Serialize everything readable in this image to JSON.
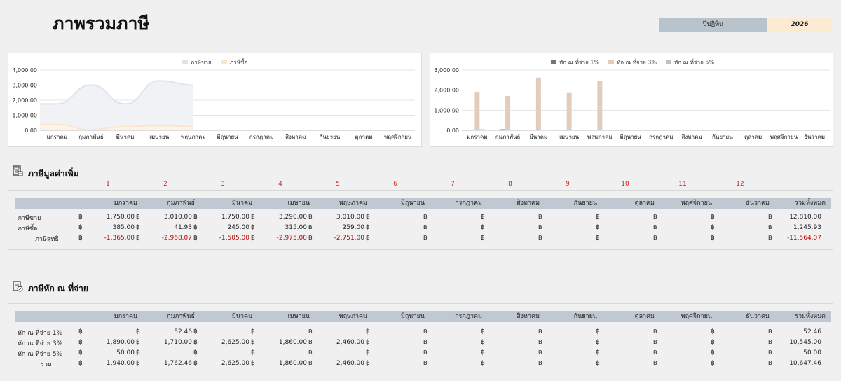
{
  "page": {
    "title": "ภาพรวมภาษี",
    "fiscal_year_label": "ปีปฏิทิน",
    "fiscal_year_value": "2026"
  },
  "months": [
    "มกราคม",
    "กุมภาพันธ์",
    "มีนาคม",
    "เมษายน",
    "พฤษภาคม",
    "มิถุนายน",
    "กรกฎาคม",
    "สิงหาคม",
    "กันยายน",
    "ตุลาคม",
    "พฤศจิกายน",
    "ธันวาคม"
  ],
  "total_label": "รวมทั้งหมด",
  "currency": "฿",
  "chart_data": [
    {
      "type": "area",
      "legend": [
        "ภาษีขาย",
        "ภาษีซื้อ"
      ],
      "legend_position": "top",
      "categories": [
        "มกราคม",
        "กุมภาพันธ์",
        "มีนาคม",
        "เมษายน",
        "พฤษภาคม",
        "มิถุนายน",
        "กรกฎาคม",
        "สิงหาคม",
        "กันยายน",
        "ตุลาคม",
        "พฤศจิกายน"
      ],
      "series": [
        {
          "name": "ภาษีขาย",
          "values": [
            1750,
            3010,
            1750,
            3290,
            3010
          ],
          "color": "#dfe3ec"
        },
        {
          "name": "ภาษีซื้อ",
          "values": [
            385,
            41.93,
            245,
            315,
            259
          ],
          "color": "#fbe6cd"
        }
      ],
      "yticks": [
        "0.00",
        "1,000.00",
        "2,000.00",
        "3,000.00",
        "4,000.00"
      ],
      "ylim": [
        0,
        4000
      ],
      "grid": true
    },
    {
      "type": "bar",
      "legend": [
        "หัก ณ ที่จ่าย 1%",
        "หัก ณ ที่จ่าย 3%",
        "หัก ณ ที่จ่าย 5%"
      ],
      "legend_position": "top",
      "categories": [
        "มกราคม",
        "กุมภาพันธ์",
        "มีนาคม",
        "เมษายน",
        "พฤษภาคม",
        "มิถุนายน",
        "กรกฎาคม",
        "สิงหาคม",
        "กันยายน",
        "ตุลาคม",
        "พฤศจิกายน",
        "ธันวาคม"
      ],
      "series": [
        {
          "name": "หัก ณ ที่จ่าย 1%",
          "values": [
            0,
            52.46,
            0,
            0,
            0,
            0,
            0,
            0,
            0,
            0,
            0,
            0
          ],
          "color": "#7a7470"
        },
        {
          "name": "หัก ณ ที่จ่าย 3%",
          "values": [
            1890,
            1710,
            2625,
            1860,
            2460,
            0,
            0,
            0,
            0,
            0,
            0,
            0
          ],
          "color": "#e2cdbd"
        },
        {
          "name": "หัก ณ ที่จ่าย 5%",
          "values": [
            50,
            0,
            0,
            0,
            0,
            0,
            0,
            0,
            0,
            0,
            0,
            0
          ],
          "color": "#b9c3cc"
        }
      ],
      "yticks": [
        "0.00",
        "1,000.00",
        "2,000.00",
        "3,000.00"
      ],
      "ylim": [
        0,
        3000
      ],
      "grid": true
    }
  ],
  "vat": {
    "title": "ภาษีมูลค่าเพิ่ม",
    "month_numbers": [
      "1",
      "2",
      "3",
      "4",
      "5",
      "6",
      "7",
      "8",
      "9",
      "10",
      "11",
      "12"
    ],
    "rows": [
      {
        "label": "ภาษีขาย",
        "values": [
          "1,750.00",
          "3,010.00",
          "1,750.00",
          "3,290.00",
          "3,010.00",
          "",
          "",
          "",
          "",
          "",
          "",
          ""
        ],
        "total": "12,810.00",
        "negative": false
      },
      {
        "label": "ภาษีซื้อ",
        "values": [
          "385.00",
          "41.93",
          "245.00",
          "315.00",
          "259.00",
          "",
          "",
          "",
          "",
          "",
          "",
          ""
        ],
        "total": "1,245.93",
        "negative": false
      },
      {
        "label": "ภาษีสุทธิ",
        "values": [
          "-1,365.00",
          "-2,968.07",
          "-1,505.00",
          "-2,975.00",
          "-2,751.00",
          "",
          "",
          "",
          "",
          "",
          "",
          ""
        ],
        "total": "-11,564.07",
        "negative": true
      }
    ]
  },
  "wht": {
    "title": "ภาษีหัก ณ ที่จ่าย",
    "rows": [
      {
        "label": "หัก ณ ที่จ่าย 1%",
        "values": [
          "",
          "52.46",
          "",
          "",
          "",
          "",
          "",
          "",
          "",
          "",
          "",
          ""
        ],
        "total": "52.46"
      },
      {
        "label": "หัก ณ ที่จ่าย 3%",
        "values": [
          "1,890.00",
          "1,710.00",
          "2,625.00",
          "1,860.00",
          "2,460.00",
          "",
          "",
          "",
          "",
          "",
          "",
          ""
        ],
        "total": "10,545.00"
      },
      {
        "label": "หัก ณ ที่จ่าย 5%",
        "values": [
          "50.00",
          "",
          "",
          "",
          "",
          "",
          "",
          "",
          "",
          "",
          "",
          ""
        ],
        "total": "50.00"
      },
      {
        "label": "รวม",
        "values": [
          "1,940.00",
          "1,762.46",
          "2,625.00",
          "1,860.00",
          "2,460.00",
          "",
          "",
          "",
          "",
          "",
          "",
          ""
        ],
        "total": "10,647.46"
      }
    ]
  }
}
